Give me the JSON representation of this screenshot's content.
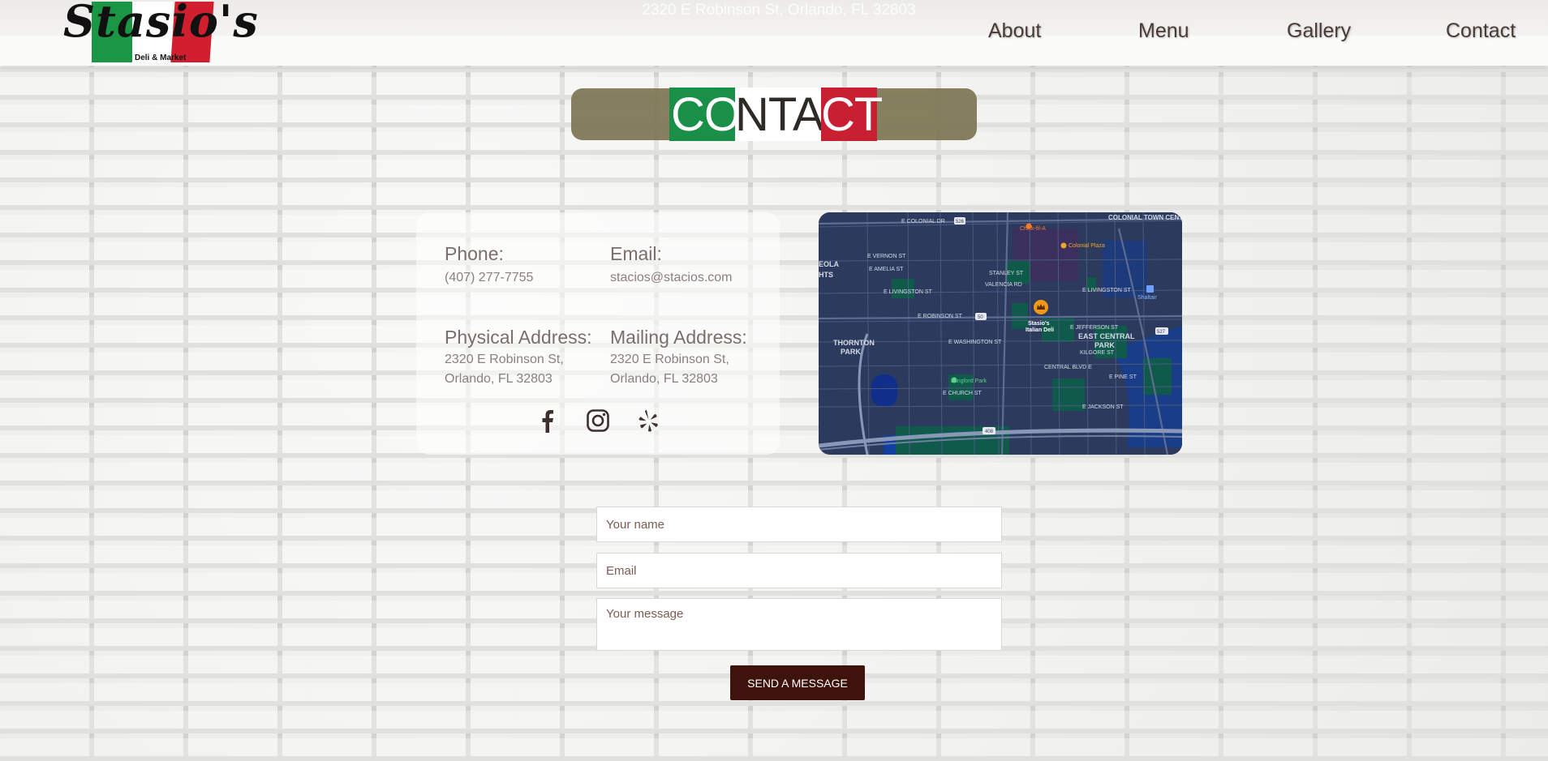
{
  "header": {
    "address": "2320 E Robinson St, Orlando, FL 32803",
    "logo": {
      "name": "Stasio's",
      "tagline": "Deli & Market"
    },
    "nav": [
      "About",
      "Menu",
      "Gallery",
      "Contact"
    ]
  },
  "title": {
    "part1": "CO",
    "part2": "NTA",
    "part3": "CT"
  },
  "contact": {
    "phone_label": "Phone:",
    "phone": "(407) 277-7755",
    "email_label": "Email:",
    "email": "stacios@stacios.com",
    "physical_label": "Physical Address:",
    "physical_line1": "2320 E Robinson St,",
    "physical_line2": "Orlando, FL 32803",
    "mailing_label": "Mailing Address:",
    "mailing_line1": "2320 E Robinson St,",
    "mailing_line2": "Orlando, FL 32803",
    "social": [
      "facebook-icon",
      "instagram-icon",
      "yelp-icon"
    ]
  },
  "map": {
    "labels": {
      "colonial_town_center": "COLONIAL TOWN CENTER",
      "chick": "Chick-fil-A",
      "colonial_plaza": "Colonial Plaza",
      "ola": "EOLA",
      "hts": "HTS",
      "vernon": "E VERNON ST",
      "colonial_dr": "E COLONIAL DR",
      "amelia": "E AMELIA ST",
      "stanley": "STANLEY ST",
      "valencia": "VALENCIA RD",
      "livingston": "E LIVINGSTON ST",
      "livingston2": "E LIVINGSTON ST",
      "shaltair": "Shaltair",
      "robinson": "E ROBINSON ST",
      "stasios": "Stasio's",
      "italian_deli": "Italian Deli",
      "jefferson": "E JEFFERSON ST",
      "thornton": "THORNTON",
      "park": "PARK",
      "washington": "E WASHINGTON ST",
      "east_central": "EAST CENTRAL",
      "park2": "PARK",
      "kilgore": "KILGORE ST",
      "central_blvd": "CENTRAL BLVD E",
      "pine": "E PINE ST",
      "langford": "Langford Park",
      "church": "E CHURCH ST",
      "jackson": "E JACKSON ST",
      "s408": "408",
      "s50": "50",
      "s526": "526",
      "s527": "527"
    }
  },
  "form": {
    "name_placeholder": "Your name",
    "email_placeholder": "Email",
    "message_placeholder": "Your message",
    "submit_label": "SEND A MESSAGE"
  }
}
